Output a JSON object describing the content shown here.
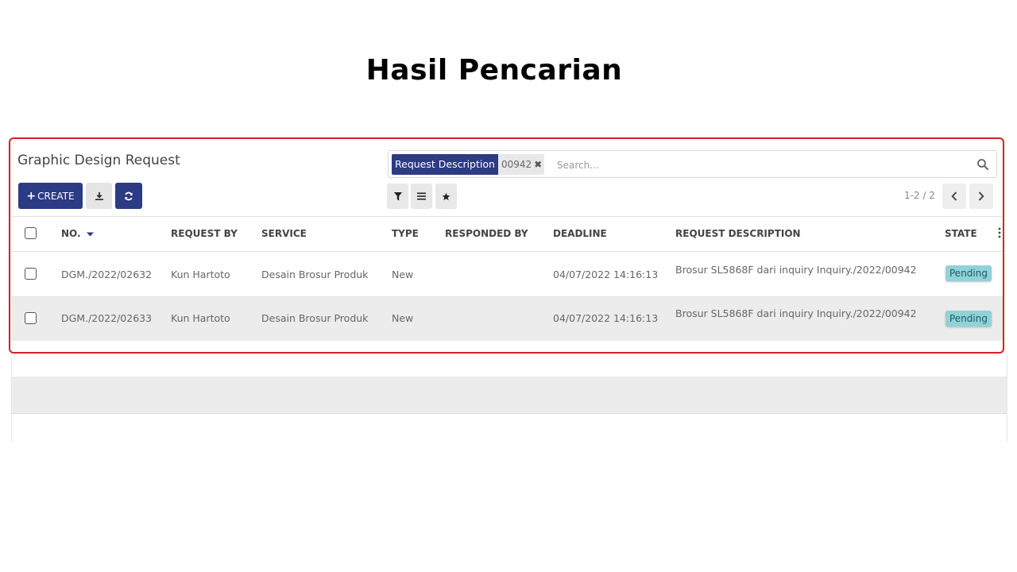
{
  "slide": {
    "title": "Hasil Pencarian"
  },
  "app": {
    "page_title": "Graphic Design Request",
    "search": {
      "facet_label": "Request Description",
      "facet_value": "00942",
      "placeholder": "Search..."
    },
    "toolbar": {
      "create_label": "CREATE"
    },
    "pager": {
      "text": "1-2 / 2"
    },
    "table": {
      "columns": [
        "NO.",
        "REQUEST BY",
        "SERVICE",
        "TYPE",
        "RESPONDED BY",
        "DEADLINE",
        "REQUEST DESCRIPTION",
        "STATE"
      ],
      "rows": [
        {
          "no": "DGM./2022/02632",
          "request_by": "Kun Hartoto",
          "service": "Desain Brosur Produk",
          "type": "New",
          "responded_by": "",
          "deadline": "04/07/2022 14:16:13",
          "description": "Brosur SL5868F dari inquiry Inquiry./2022/00942",
          "state": "Pending"
        },
        {
          "no": "DGM./2022/02633",
          "request_by": "Kun Hartoto",
          "service": "Desain Brosur Produk",
          "type": "New",
          "responded_by": "",
          "deadline": "04/07/2022 14:16:13",
          "description": "Brosur SL5868F dari inquiry Inquiry./2022/00942",
          "state": "Pending"
        }
      ]
    }
  },
  "icons": [
    "plus-icon",
    "download-icon",
    "refresh-icon",
    "filter-icon",
    "group-by-icon",
    "favorite-star-icon",
    "search-icon",
    "chevron-left-icon",
    "chevron-right-icon",
    "sort-desc-icon",
    "column-options-icon",
    "close-icon"
  ],
  "colors": {
    "primary": "#2d3a84",
    "highlight_border": "#d4202b",
    "state_badge": "#8fd3d9",
    "row_alt": "#ececec"
  }
}
